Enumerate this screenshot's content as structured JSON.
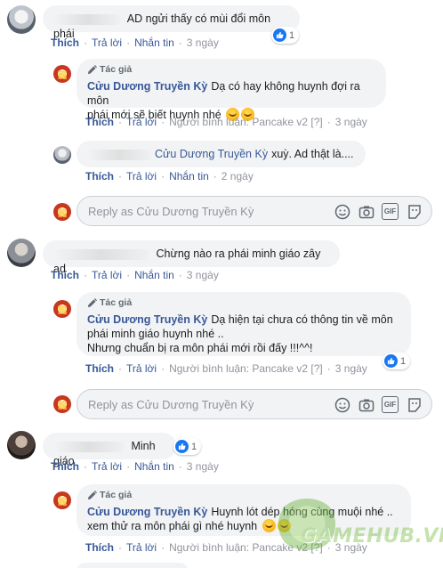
{
  "labels": {
    "like": "Thích",
    "reply": "Trả lời",
    "message": "Nhắn tin",
    "author_tag": "Tác giả",
    "responder": "Người bình luận: Pancake v2 [?]"
  },
  "page_name": "Cửu Dương Truyền Kỳ",
  "reply_placeholder": "Reply as Cửu Dương Truyền Kỳ",
  "threads": [
    {
      "comment": {
        "text": "AD ngửi thấy có mùi đổi môn phái",
        "time": "3 ngày",
        "reactions": "1"
      },
      "page_reply": {
        "text": "Dạ có hay không huynh đợi ra môn",
        "text2": "phái mới sẽ biết huynh nhé",
        "time": "3 ngày"
      },
      "sub_reply": {
        "text": "xuỳ. Ad thật là....",
        "time": "2 ngày"
      }
    },
    {
      "comment": {
        "text": "Chừng nào ra phái minh giáo zây ad",
        "time": "3 ngày"
      },
      "page_reply": {
        "line1": "Dạ hiện tại chưa có thông tin về môn",
        "line2": "phái minh giáo huynh nhé ..",
        "line3": "Nhưng chuẩn bị ra môn phái mới rồi đấy !!!^^!",
        "time": "3 ngày",
        "reactions": "1"
      }
    },
    {
      "comment": {
        "text": "Minh giáo",
        "time": "3 ngày",
        "reactions": "1"
      },
      "page_reply": {
        "line1": "Huynh lót dép hóng cùng muội nhé ..",
        "line2": "xem thử ra môn phái gì nhé huynh",
        "time": "3 ngày"
      }
    }
  ],
  "watermark": "GAMEHUB.VN",
  "colors": {
    "link": "#385898",
    "bubble": "#f2f3f5",
    "muted": "#90949c",
    "like_blue": "#1877f2"
  }
}
